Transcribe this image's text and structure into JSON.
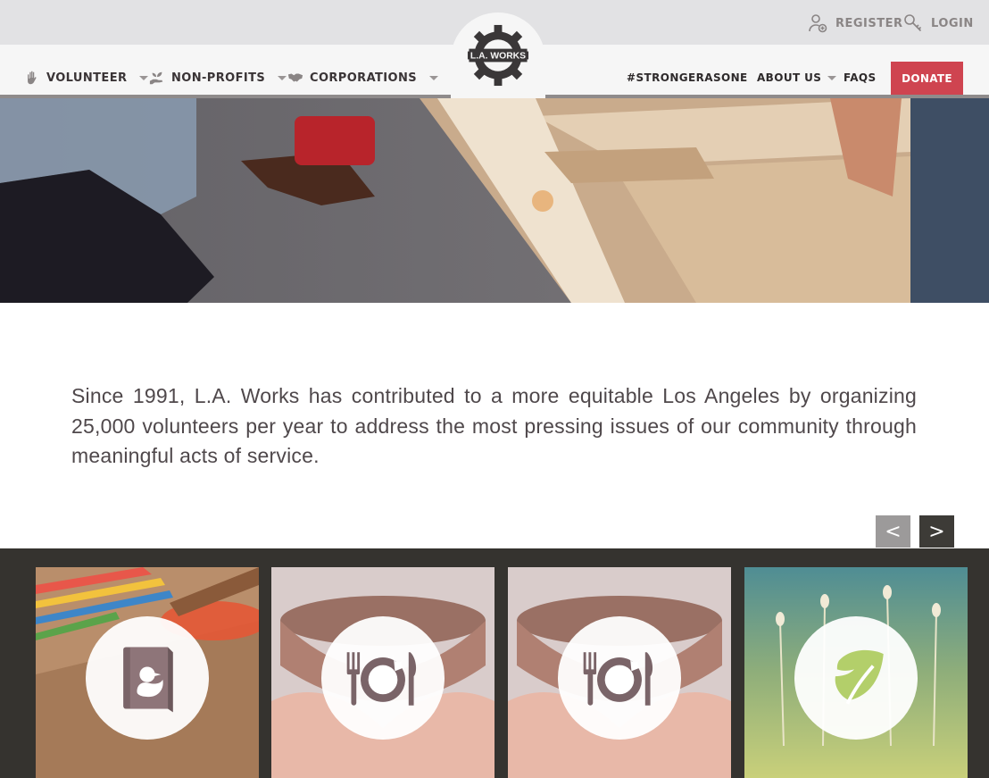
{
  "header": {
    "logo_text": "L.A. WORKS",
    "register_label": "REGISTER",
    "login_label": "LOGIN"
  },
  "nav": {
    "left": [
      {
        "label": "VOLUNTEER",
        "icon": "raised-hand-icon"
      },
      {
        "label": "NON-PROFITS",
        "icon": "hand-plant-icon"
      },
      {
        "label": "CORPORATIONS",
        "icon": "handshake-icon"
      }
    ],
    "right": {
      "hashtag": "#STRONGERASONE",
      "about": "ABOUT US",
      "faqs": "FAQS",
      "donate": "DONATE"
    }
  },
  "mission": {
    "text": "Since 1991, L.A. Works has contributed to a more equitable Los Angeles by organizing 25,000 volunteers per year to address the most pressing issues of our community through meaningful acts of service."
  },
  "carousel": {
    "prev_label": "<",
    "next_label": ">",
    "cards": [
      {
        "icon": "book-duck-icon",
        "background": "colored-pencils-and-paint-brushes"
      },
      {
        "icon": "fork-plate-knife-icon",
        "background": "hands-holding-bowl"
      },
      {
        "icon": "fork-plate-knife-icon",
        "background": "hands-holding-bowl"
      },
      {
        "icon": "leaf-icon",
        "background": "grass-and-flowers"
      }
    ]
  },
  "colors": {
    "accent_donate": "#cf4450",
    "topbar": "#e2e2e4",
    "strip": "#35332f",
    "icon_mauve": "#7a6468"
  }
}
